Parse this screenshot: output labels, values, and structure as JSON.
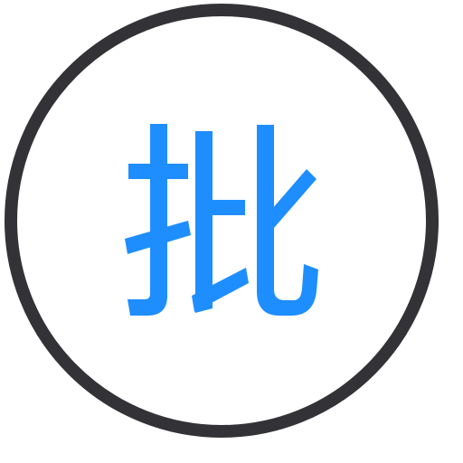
{
  "badge": {
    "character": "批",
    "icon": "approve-character-icon",
    "ring_color": "#333337",
    "glyph_color": "#1E8EFF",
    "background_color": "#FFFFFF"
  }
}
